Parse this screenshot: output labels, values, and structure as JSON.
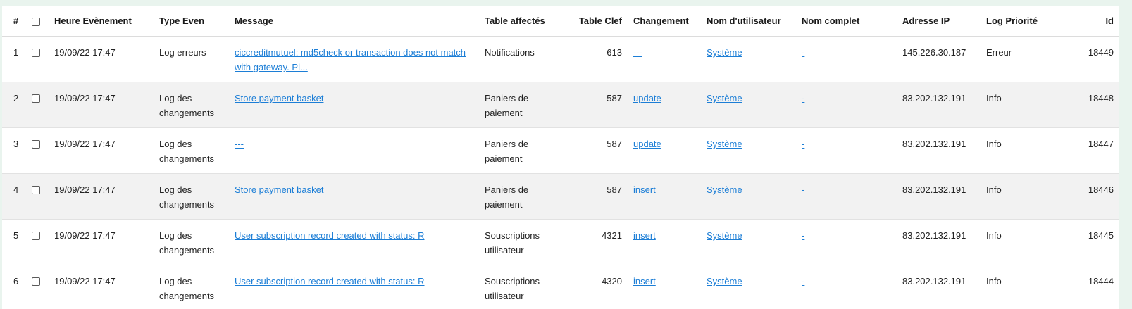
{
  "colors": {
    "link": "#1c7ed6",
    "row_alt": "#f2f2f2",
    "page_bg": "#e9f4ee"
  },
  "headers": {
    "index": "#",
    "datetime": "Heure Evènement",
    "type": "Type Even",
    "message": "Message",
    "table": "Table affectés",
    "key": "Table Clef",
    "change": "Changement",
    "username": "Nom d'utilisateur",
    "fullname": "Nom complet",
    "ip": "Adresse IP",
    "priority": "Log Priorité",
    "id": "Id"
  },
  "rows": [
    {
      "index": "1",
      "datetime": "19/09/22 17:47",
      "type": "Log erreurs",
      "message": "ciccreditmutuel: md5check or transaction does not match with gateway. Pl...",
      "table": "Notifications",
      "key": "613",
      "change": "---",
      "username": "Système",
      "fullname": "-",
      "ip": "145.226.30.187",
      "priority": "Erreur",
      "id": "18449"
    },
    {
      "index": "2",
      "datetime": "19/09/22 17:47",
      "type": "Log des changements",
      "message": "Store payment basket",
      "table": "Paniers de paiement",
      "key": "587",
      "change": "update",
      "username": "Système",
      "fullname": "-",
      "ip": "83.202.132.191",
      "priority": "Info",
      "id": "18448"
    },
    {
      "index": "3",
      "datetime": "19/09/22 17:47",
      "type": "Log des changements",
      "message": "---",
      "table": "Paniers de paiement",
      "key": "587",
      "change": "update",
      "username": "Système",
      "fullname": "-",
      "ip": "83.202.132.191",
      "priority": "Info",
      "id": "18447"
    },
    {
      "index": "4",
      "datetime": "19/09/22 17:47",
      "type": "Log des changements",
      "message": "Store payment basket",
      "table": "Paniers de paiement",
      "key": "587",
      "change": "insert",
      "username": "Système",
      "fullname": "-",
      "ip": "83.202.132.191",
      "priority": "Info",
      "id": "18446"
    },
    {
      "index": "5",
      "datetime": "19/09/22 17:47",
      "type": "Log des changements",
      "message": "User subscription record created with status: R",
      "table": "Souscriptions utilisateur",
      "key": "4321",
      "change": "insert",
      "username": "Système",
      "fullname": "-",
      "ip": "83.202.132.191",
      "priority": "Info",
      "id": "18445"
    },
    {
      "index": "6",
      "datetime": "19/09/22 17:47",
      "type": "Log des changements",
      "message": "User subscription record created with status: R",
      "table": "Souscriptions utilisateur",
      "key": "4320",
      "change": "insert",
      "username": "Système",
      "fullname": "-",
      "ip": "83.202.132.191",
      "priority": "Info",
      "id": "18444"
    }
  ]
}
